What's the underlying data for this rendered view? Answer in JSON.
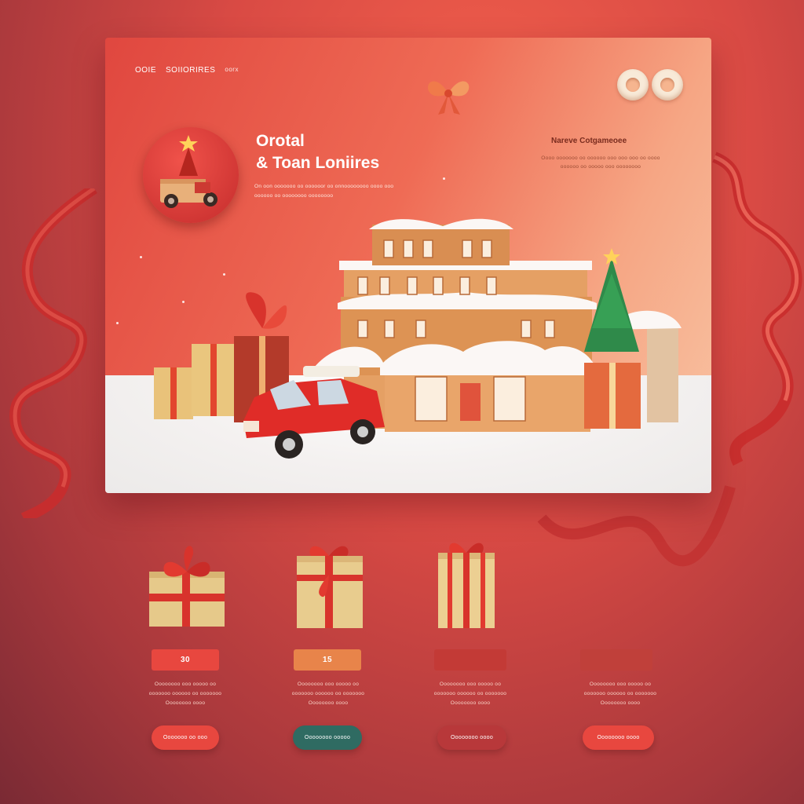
{
  "colors": {
    "accent": "#e8473f",
    "teal": "#2f6b62",
    "cream": "#f8ead8",
    "gold": "#e8c87a"
  },
  "nav": {
    "items": [
      "OOIE",
      "SOIIORIRES"
    ],
    "extra": "oorx"
  },
  "hero": {
    "title_line1": "Orotal",
    "title_line2": "& Toan Loniires",
    "desc": "On oon ooooooo oo oooooor oo onnoooooooo oooo ooo oooooo oo oooooooo oooooooo"
  },
  "aside": {
    "title": "Nareve Cotgameoee",
    "desc": "Oooo ooooooo oo oooooo ooo ooo ooo oo oooo oooooo oo ooooo ooo oooooooo"
  },
  "icons": [
    "bow-icon",
    "toggle-icon",
    "tree-icon",
    "gift-icon",
    "car-icon",
    "house-icon"
  ],
  "products": [
    {
      "price": "30",
      "desc_line1": "Oooooooo ooo ooooo oo",
      "desc_line2": "ooooooo oooooo oo ooooooo",
      "desc_line3": "Oooooooo oooo",
      "button": "Ooooooo oo ooo",
      "button_color": "#e8473f",
      "price_color": "#e8473f"
    },
    {
      "price": "15",
      "desc_line1": "Oooooooo ooo ooooo oo",
      "desc_line2": "ooooooo oooooo oo ooooooo",
      "desc_line3": "Oooooooo oooo",
      "button": "Oooooooo ooooo",
      "button_color": "#2f6b62",
      "price_color": "#e8844a"
    },
    {
      "price": "",
      "desc_line1": "Oooooooo ooo ooooo oo",
      "desc_line2": "ooooooo oooooo oo ooooooo",
      "desc_line3": "Oooooooo oooo",
      "button": "Oooooooo oooo",
      "button_color": "#b8383a",
      "price_color": "#c33a36"
    },
    {
      "price": "",
      "desc_line1": "Oooooooo ooo ooooo oo",
      "desc_line2": "ooooooo oooooo oo ooooooo",
      "desc_line3": "Oooooooo oooo",
      "button": "Oooooooo oooo",
      "button_color": "#e8473f",
      "price_color": "#c0403a"
    }
  ]
}
